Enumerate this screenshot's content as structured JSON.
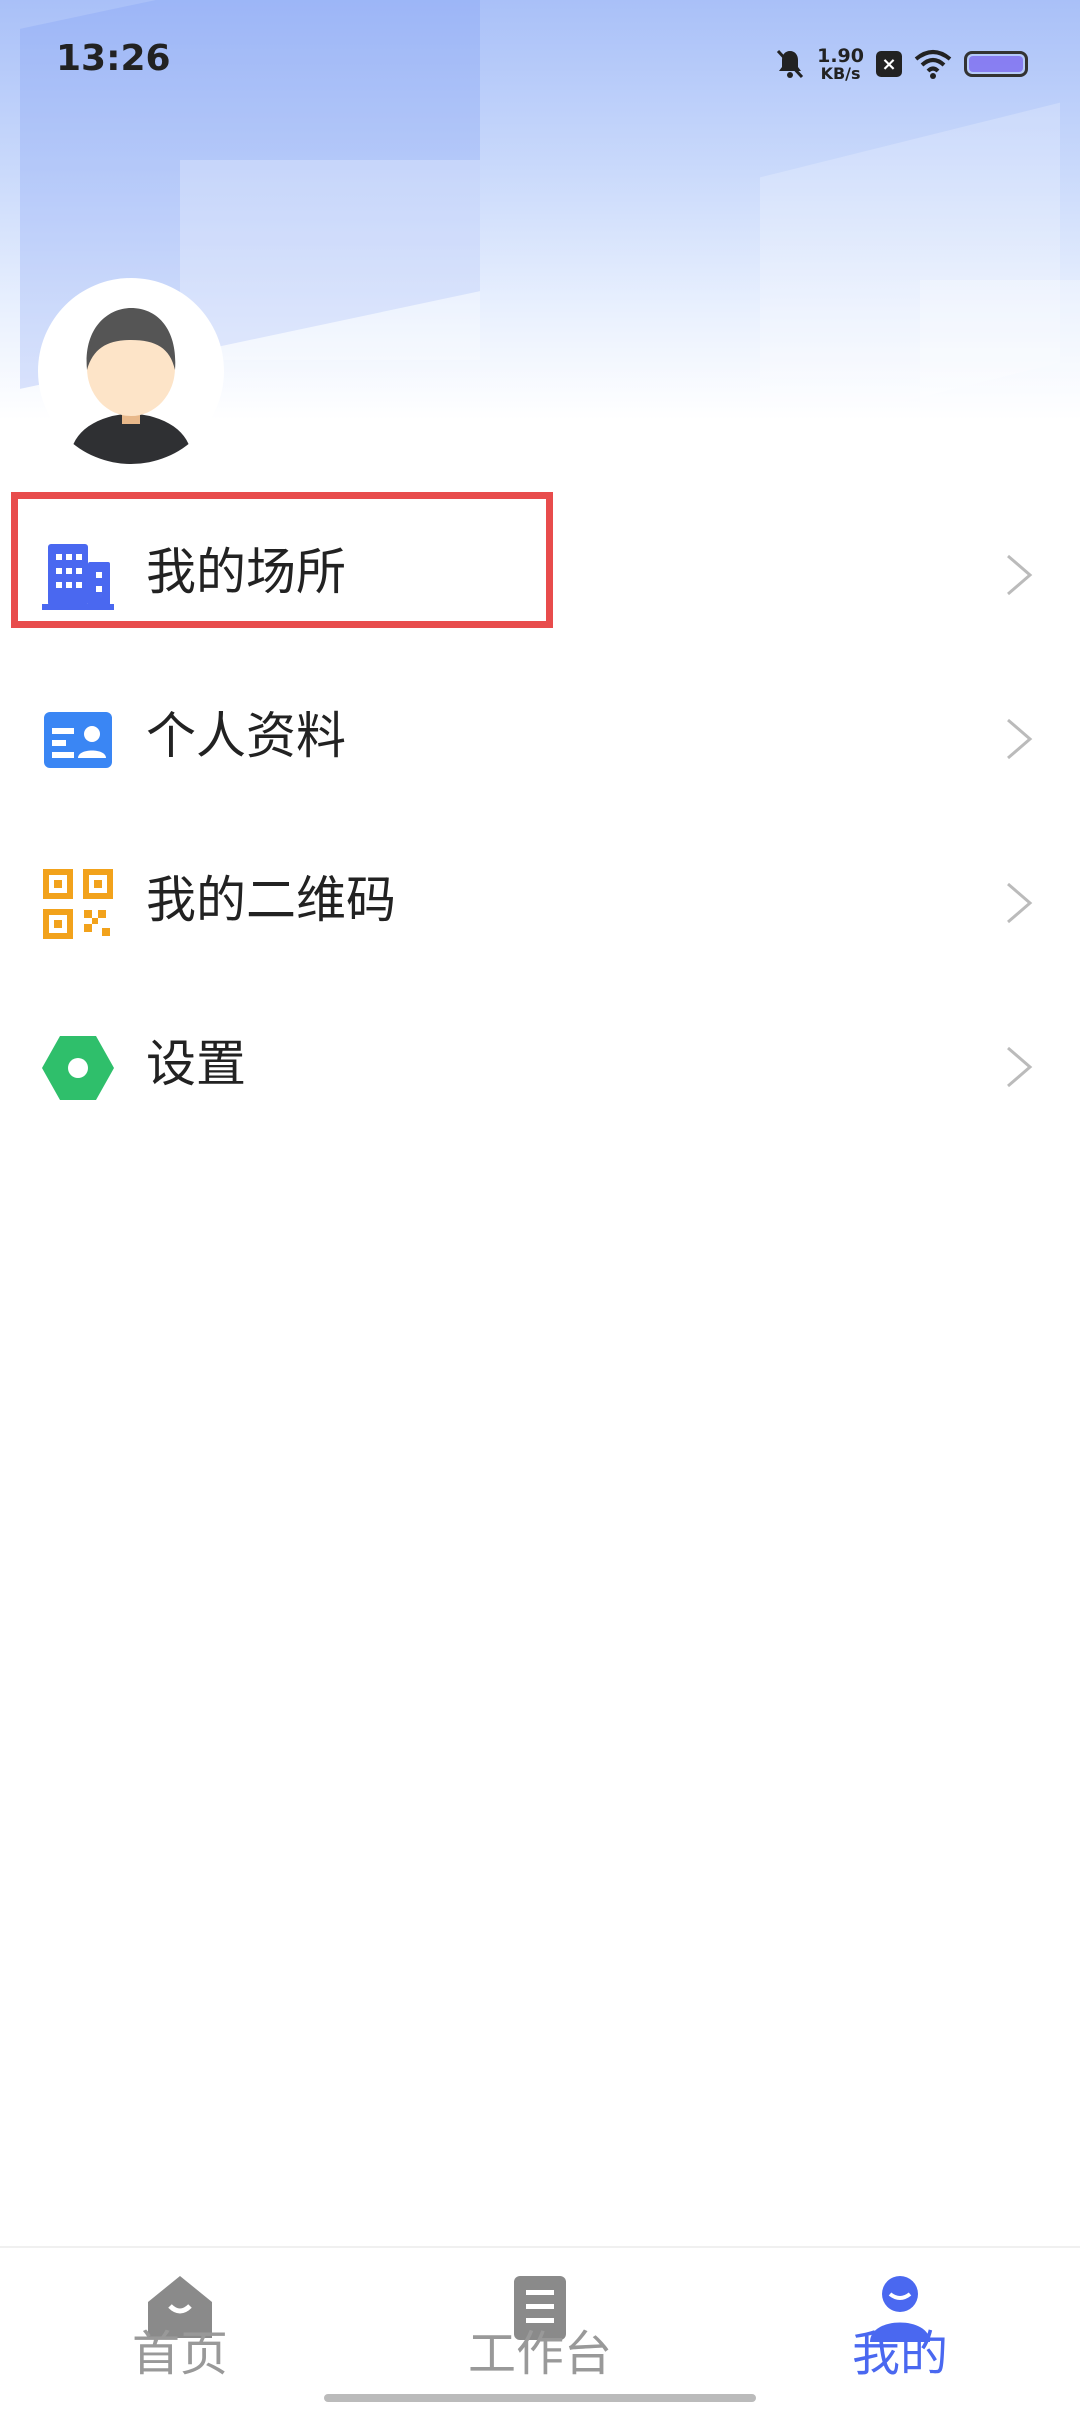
{
  "status_bar": {
    "time": "13:26",
    "net_speed_value": "1.90",
    "net_speed_unit": "KB/s",
    "icons": [
      "mute-bell-icon",
      "close-box-icon",
      "wifi-icon",
      "battery-icon"
    ]
  },
  "profile": {
    "avatar_icon": "user-avatar-icon"
  },
  "menu": {
    "items": [
      {
        "label": "我的场所",
        "icon": "building-icon",
        "color": "#4a68f0"
      },
      {
        "label": "个人资料",
        "icon": "id-card-icon",
        "color": "#3a86f4"
      },
      {
        "label": "我的二维码",
        "icon": "qr-code-icon",
        "color": "#f2a21b"
      },
      {
        "label": "设置",
        "icon": "hexagon-settings-icon",
        "color": "#2fbf6b"
      }
    ]
  },
  "tabbar": {
    "tabs": [
      {
        "label": "首页",
        "icon": "home-icon",
        "active": false
      },
      {
        "label": "工作台",
        "icon": "clipboard-icon",
        "active": false
      },
      {
        "label": "我的",
        "icon": "person-icon",
        "active": true
      }
    ],
    "active_color": "#4a68f0",
    "inactive_color": "#999999"
  }
}
